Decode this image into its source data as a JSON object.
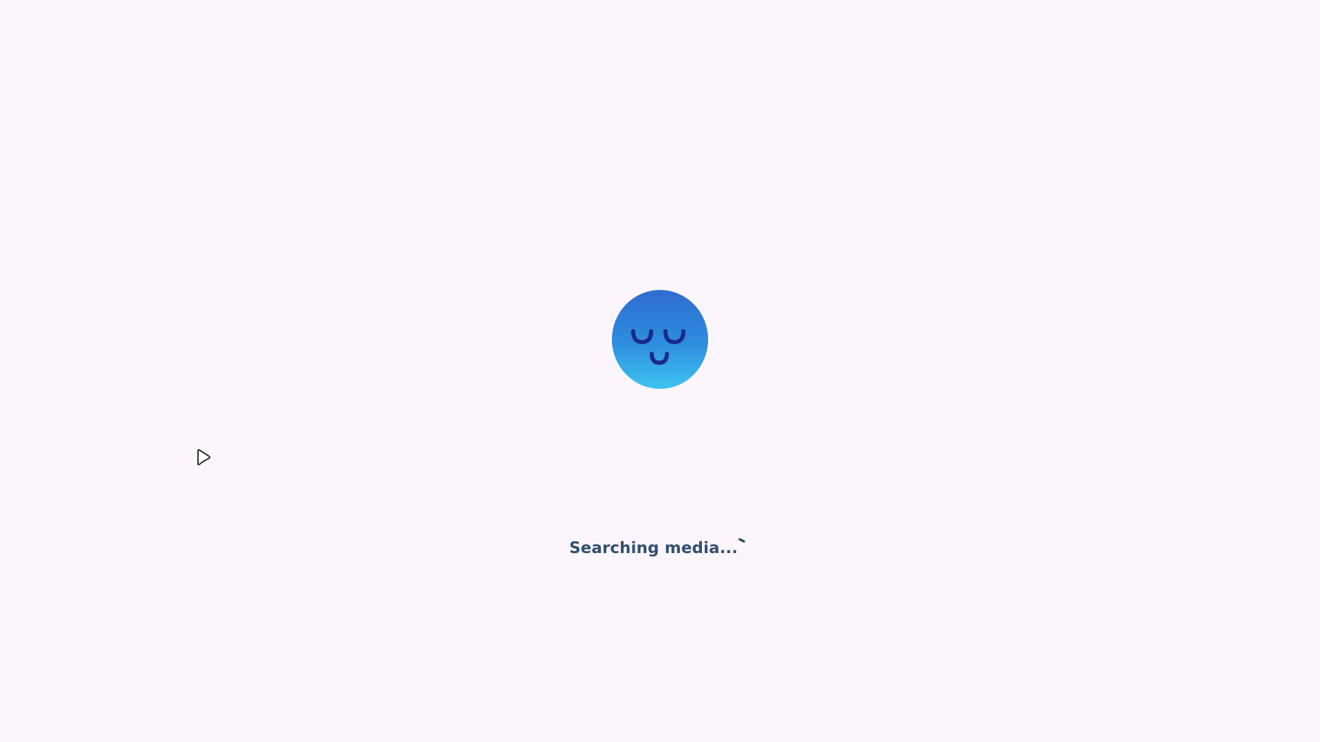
{
  "status": {
    "text": "Searching media..."
  },
  "logo": {
    "icon": "sleeping-face-icon",
    "gradient_top": "#2f6fd1",
    "gradient_bottom": "#3cc0ee",
    "feature_color": "#1a2a8a"
  },
  "spinner": {
    "icon": "loading-spinner-icon",
    "color": "#33506f"
  },
  "cursor": {
    "icon": "mouse-pointer-icon"
  },
  "colors": {
    "background": "#fcf6fc",
    "status_text": "#33506f"
  }
}
